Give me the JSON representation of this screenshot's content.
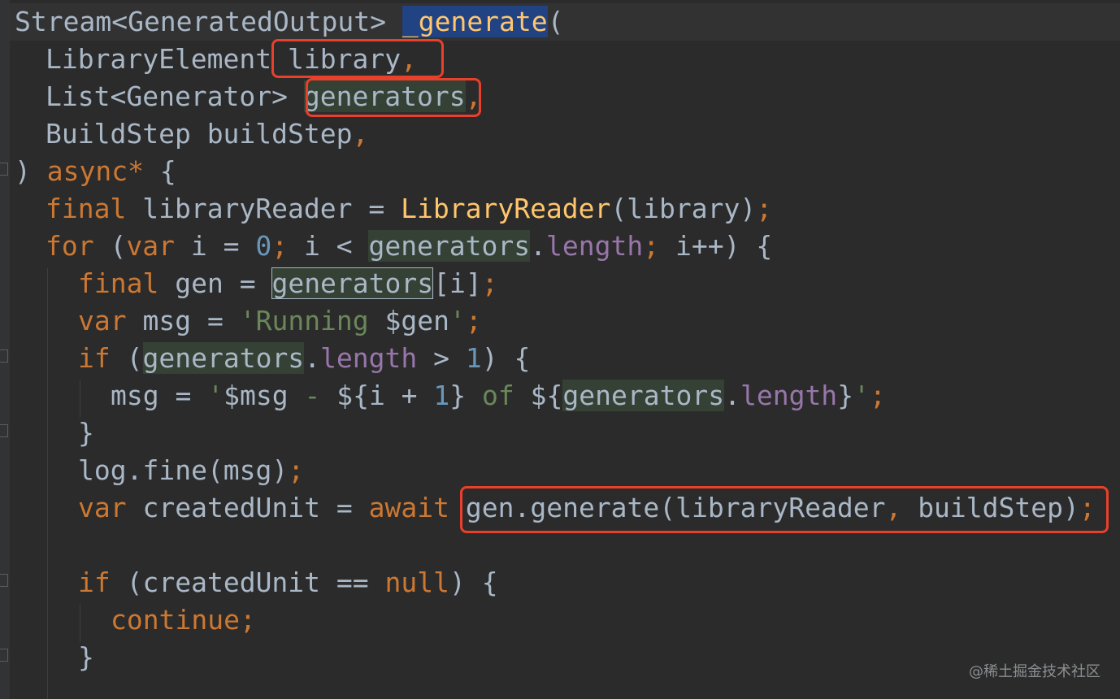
{
  "code": {
    "line1": {
      "type": "Stream<GeneratedOutput>",
      "fn": "_generate",
      "open": "("
    },
    "line2": {
      "type": "LibraryElement",
      "param": "library",
      "comma": ","
    },
    "line3": {
      "type": "List<Generator>",
      "param": "generators",
      "comma": ","
    },
    "line4": {
      "type": "BuildStep",
      "param": "buildStep",
      "comma": ","
    },
    "line5": {
      "close": ")",
      "kw": "async*",
      "brace": "{"
    },
    "line6": {
      "kw": "final",
      "name": "libraryReader",
      "op": "=",
      "fn": "LibraryReader",
      "args": "(library)",
      "semi": ";"
    },
    "line7": {
      "kw_for": "for",
      "paren": "(",
      "kw_var": "var",
      "i": "i",
      "eq": "=",
      "zero": "0",
      "semi1": ";",
      "cond": "i <",
      "gens": "generators",
      "dot": ".",
      "length": "length",
      "semi2": ";",
      "inc": "i++)",
      "brace": "{"
    },
    "line8": {
      "kw": "final",
      "name": "gen",
      "eq": "=",
      "gens": "generators",
      "idx": "[i]",
      "semi": ";"
    },
    "line9": {
      "kw": "var",
      "name": "msg",
      "eq": "=",
      "str": "'Running ",
      "interp": "$gen",
      "str_end": "'",
      "semi": ";"
    },
    "line10": {
      "kw": "if",
      "paren": "(",
      "gens": "generators",
      "dot": ".",
      "length": "length",
      "op": "> ",
      "one": "1",
      "close": ")",
      "brace": "{"
    },
    "line11": {
      "name": "msg",
      "eq": "=",
      "q": "'",
      "interp1": "$msg",
      "str1": " - ",
      "interp_open": "${i + ",
      "one": "1",
      "interp_close": "}",
      "str2": " of ",
      "interp2_open": "${",
      "gens": "generators",
      "dot": ".",
      "length": "length",
      "interp2_close": "}",
      "q_end": "'",
      "semi": ";"
    },
    "line12": {
      "brace": "}"
    },
    "line13": {
      "call": "log.fine(msg)",
      "semi": ";"
    },
    "line14": {
      "kw": "var",
      "name": "createdUnit",
      "eq": "=",
      "kw_await": "await",
      "call": "gen.generate(libraryReader",
      "comma": ",",
      "arg2": "buildStep)",
      "semi": ";"
    },
    "line16": {
      "kw": "if",
      "cond": "(createdUnit ==",
      "null_kw": "null",
      "close": ")",
      "brace": "{"
    },
    "line17": {
      "kw": "continue",
      "semi": ";"
    },
    "line18": {
      "brace": "}"
    }
  },
  "watermark": "@稀土掘金技术社区",
  "colors": {
    "background": "#2b2b2b",
    "keyword": "#cc7832",
    "function": "#ffc66d",
    "number": "#6897bb",
    "string": "#6a8759",
    "property": "#9876aa",
    "annotation_box": "#e8402b"
  }
}
